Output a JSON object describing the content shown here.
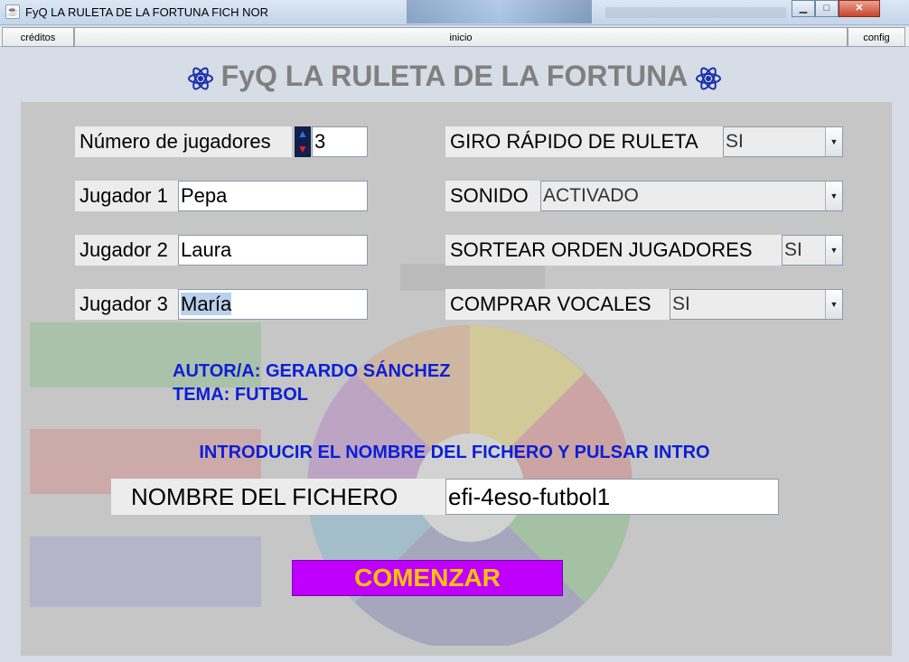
{
  "window": {
    "title": "FyQ LA RULETA DE LA FORTUNA FICH NOR",
    "min_label": "▁",
    "max_label": "□",
    "close_label": "✕"
  },
  "menu": {
    "credits": "créditos",
    "home": "inicio",
    "config": "config"
  },
  "heading": "FyQ LA RULETA DE LA FORTUNA",
  "players": {
    "count_label": "Número de jugadores",
    "count_value": "3",
    "list": [
      {
        "label": "Jugador 1",
        "value": "Pepa"
      },
      {
        "label": "Jugador 2",
        "value": "Laura"
      },
      {
        "label": "Jugador 3",
        "value": "María"
      }
    ]
  },
  "options": [
    {
      "label": "GIRO RÁPIDO DE RULETA",
      "value": "SI"
    },
    {
      "label": "SONIDO",
      "value": "ACTIVADO"
    },
    {
      "label": "SORTEAR ORDEN JUGADORES",
      "value": "SI"
    },
    {
      "label": "COMPRAR VOCALES",
      "value": "SI"
    }
  ],
  "author": "AUTOR/A: GERARDO SÁNCHEZ",
  "topic": "TEMA: FUTBOL",
  "instruction": "INTRODUCIR EL NOMBRE DEL FICHERO Y PULSAR INTRO",
  "file": {
    "label": "NOMBRE DEL FICHERO",
    "value": "efi-4eso-futbol1"
  },
  "start_label": "COMENZAR",
  "colors": {
    "accent_blue": "#0b1fd6",
    "start_bg": "#c000ff",
    "start_text": "#ffc400",
    "panel": "#c6c6c6"
  },
  "icons": {
    "app": "java-icon",
    "heading": "atom-icon"
  }
}
